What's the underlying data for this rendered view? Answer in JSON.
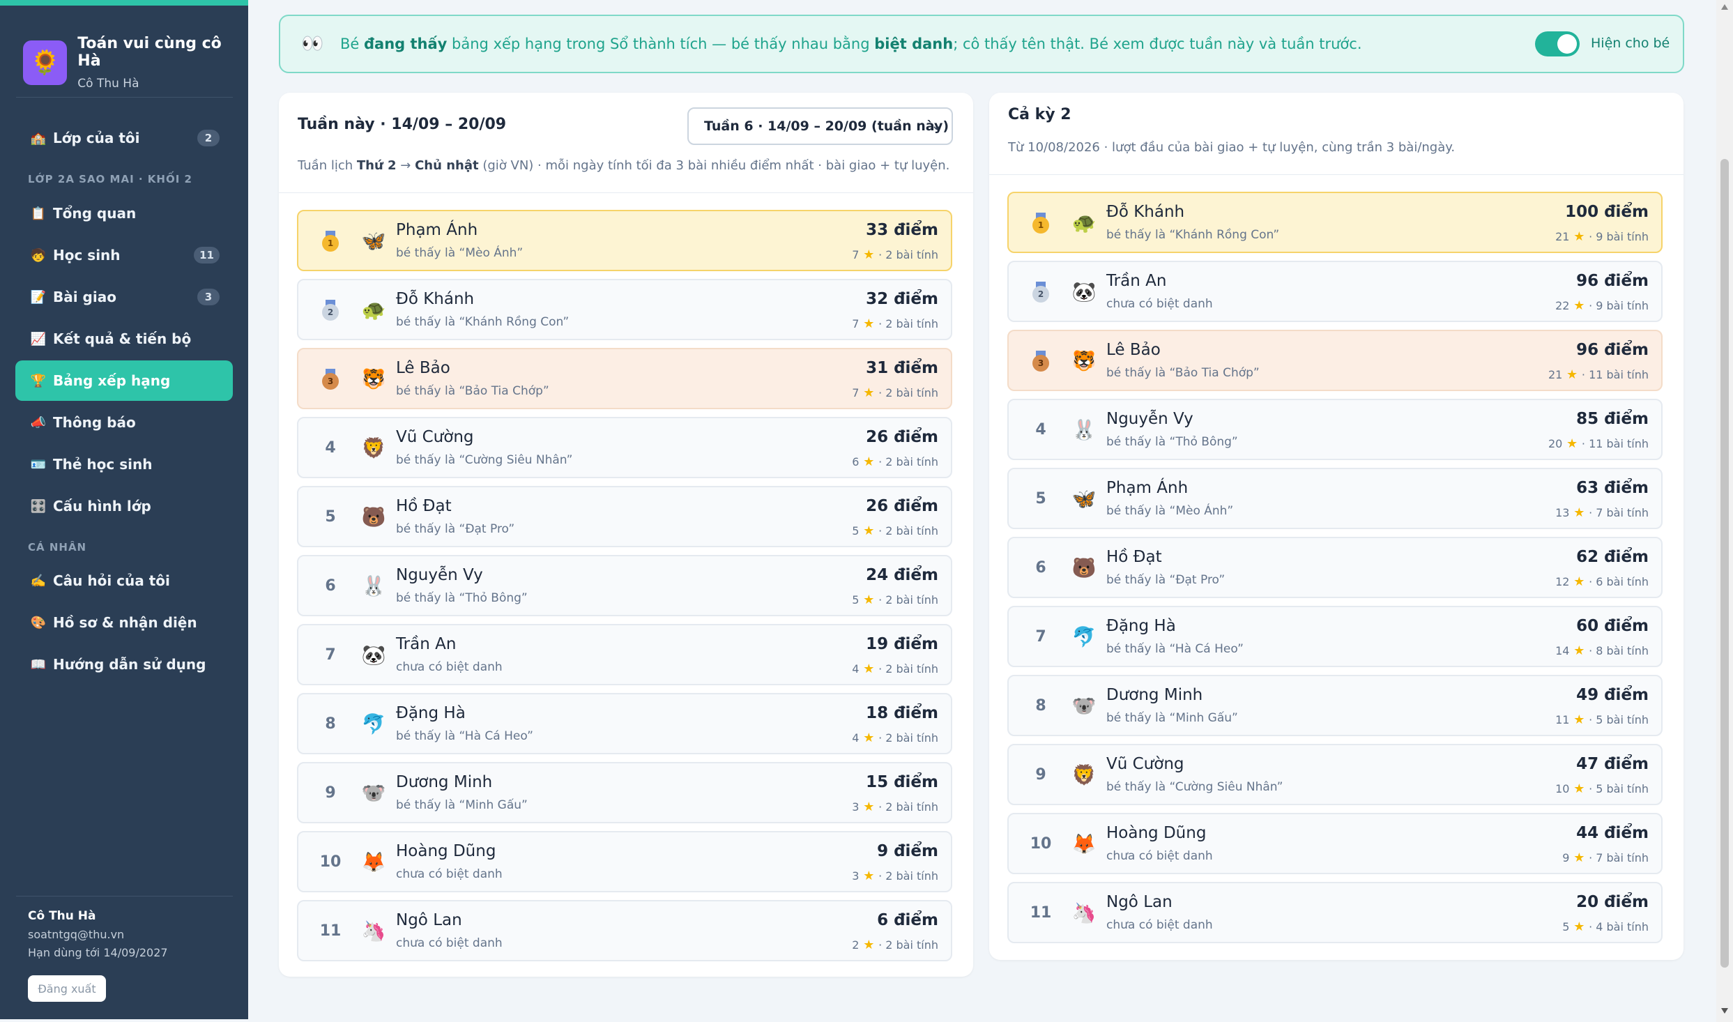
{
  "brand": {
    "logo": "🌻",
    "title": "Toán vui cùng cô Hà",
    "subtitle": "Cô Thu Hà"
  },
  "sidebar": {
    "top_item": {
      "icon": "🏫",
      "label": "Lớp của tôi",
      "badge": "2"
    },
    "class_section": "LỚP 2A SAO MAI · KHỐI 2",
    "class_items": [
      {
        "icon": "📋",
        "label": "Tổng quan",
        "badge": ""
      },
      {
        "icon": "🧒",
        "label": "Học sinh",
        "badge": "11"
      },
      {
        "icon": "📝",
        "label": "Bài giao",
        "badge": "3"
      },
      {
        "icon": "📈",
        "label": "Kết quả & tiến bộ",
        "badge": ""
      },
      {
        "icon": "🏆",
        "label": "Bảng xếp hạng",
        "badge": ""
      },
      {
        "icon": "📣",
        "label": "Thông báo",
        "badge": ""
      },
      {
        "icon": "🪪",
        "label": "Thẻ học sinh",
        "badge": ""
      },
      {
        "icon": "🎛️",
        "label": "Cấu hình lớp",
        "badge": ""
      }
    ],
    "personal_section": "CÁ NHÂN",
    "personal_items": [
      {
        "icon": "✍️",
        "label": "Câu hỏi của tôi"
      },
      {
        "icon": "🎨",
        "label": "Hồ sơ & nhận diện"
      },
      {
        "icon": "📖",
        "label": "Hướng dẫn sử dụng"
      }
    ],
    "user": {
      "name": "Cô Thu Hà",
      "email": "soatntgq@thu.vn",
      "expiry": "Hạn dùng tới 14/09/2027",
      "logout": "Đăng xuất"
    }
  },
  "banner": {
    "icon": "👀",
    "t1": "Bé ",
    "b1": "đang thấy",
    "t2": " bảng xếp hạng trong Sổ thành tích — bé thấy nhau bằng ",
    "b2": "biệt danh",
    "t3": "; cô thấy tên thật. Bé xem được tuần này và tuần trước.",
    "toggle_label": "Hiện cho bé",
    "toggle_on": true
  },
  "week": {
    "title": "Tuần này · 14/09 – 20/09",
    "select_value": "Tuần 6 · 14/09 – 20/09 (tuần này)",
    "desc_1": "Tuần lịch ",
    "desc_b1": "Thứ 2",
    "desc_2": " → ",
    "desc_b2": "Chủ nhật",
    "desc_3": " (giờ VN) · mỗi ngày tính tối đa 3 bài nhiều điểm nhất · bài giao + tự luyện.",
    "rows": [
      {
        "rank": "1",
        "avatar": "🦋",
        "name": "Phạm Ánh",
        "nick": "bé thấy là “Mèo Ánh”",
        "score": "33 điểm",
        "stars": "7",
        "count": "· 2 bài tính"
      },
      {
        "rank": "2",
        "avatar": "🐢",
        "name": "Đỗ Khánh",
        "nick": "bé thấy là “Khánh Rồng Con”",
        "score": "32 điểm",
        "stars": "7",
        "count": "· 2 bài tính"
      },
      {
        "rank": "3",
        "avatar": "🐯",
        "name": "Lê Bảo",
        "nick": "bé thấy là “Bảo Tia Chớp”",
        "score": "31 điểm",
        "stars": "7",
        "count": "· 2 bài tính"
      },
      {
        "rank": "4",
        "avatar": "🦁",
        "name": "Vũ Cường",
        "nick": "bé thấy là “Cường Siêu Nhân”",
        "score": "26 điểm",
        "stars": "6",
        "count": "· 2 bài tính"
      },
      {
        "rank": "5",
        "avatar": "🐻",
        "name": "Hồ Đạt",
        "nick": "bé thấy là “Đạt Pro”",
        "score": "26 điểm",
        "stars": "5",
        "count": "· 2 bài tính"
      },
      {
        "rank": "6",
        "avatar": "🐰",
        "name": "Nguyễn Vy",
        "nick": "bé thấy là “Thỏ Bông”",
        "score": "24 điểm",
        "stars": "5",
        "count": "· 2 bài tính"
      },
      {
        "rank": "7",
        "avatar": "🐼",
        "name": "Trần An",
        "nick": "chưa có biệt danh",
        "score": "19 điểm",
        "stars": "4",
        "count": "· 2 bài tính"
      },
      {
        "rank": "8",
        "avatar": "🐬",
        "name": "Đặng Hà",
        "nick": "bé thấy là “Hà Cá Heo”",
        "score": "18 điểm",
        "stars": "4",
        "count": "· 2 bài tính"
      },
      {
        "rank": "9",
        "avatar": "🐨",
        "name": "Dương Minh",
        "nick": "bé thấy là “Minh Gấu”",
        "score": "15 điểm",
        "stars": "3",
        "count": "· 2 bài tính"
      },
      {
        "rank": "10",
        "avatar": "🦊",
        "name": "Hoàng Dũng",
        "nick": "chưa có biệt danh",
        "score": "9 điểm",
        "stars": "3",
        "count": "· 2 bài tính"
      },
      {
        "rank": "11",
        "avatar": "🦄",
        "name": "Ngô Lan",
        "nick": "chưa có biệt danh",
        "score": "6 điểm",
        "stars": "2",
        "count": "· 2 bài tính"
      }
    ]
  },
  "term": {
    "title": "Cả kỳ 2",
    "desc": "Từ 10/08/2026 · lượt đầu của bài giao + tự luyện, cùng trần 3 bài/ngày.",
    "rows": [
      {
        "rank": "1",
        "avatar": "🐢",
        "name": "Đỗ Khánh",
        "nick": "bé thấy là “Khánh Rồng Con”",
        "score": "100 điểm",
        "stars": "21",
        "count": "· 9 bài tính"
      },
      {
        "rank": "2",
        "avatar": "🐼",
        "name": "Trần An",
        "nick": "chưa có biệt danh",
        "score": "96 điểm",
        "stars": "22",
        "count": "· 9 bài tính"
      },
      {
        "rank": "3",
        "avatar": "🐯",
        "name": "Lê Bảo",
        "nick": "bé thấy là “Bảo Tia Chớp”",
        "score": "96 điểm",
        "stars": "21",
        "count": "· 11 bài tính"
      },
      {
        "rank": "4",
        "avatar": "🐰",
        "name": "Nguyễn Vy",
        "nick": "bé thấy là “Thỏ Bông”",
        "score": "85 điểm",
        "stars": "20",
        "count": "· 11 bài tính"
      },
      {
        "rank": "5",
        "avatar": "🦋",
        "name": "Phạm Ánh",
        "nick": "bé thấy là “Mèo Ánh”",
        "score": "63 điểm",
        "stars": "13",
        "count": "· 7 bài tính"
      },
      {
        "rank": "6",
        "avatar": "🐻",
        "name": "Hồ Đạt",
        "nick": "bé thấy là “Đạt Pro”",
        "score": "62 điểm",
        "stars": "12",
        "count": "· 6 bài tính"
      },
      {
        "rank": "7",
        "avatar": "🐬",
        "name": "Đặng Hà",
        "nick": "bé thấy là “Hà Cá Heo”",
        "score": "60 điểm",
        "stars": "14",
        "count": "· 8 bài tính"
      },
      {
        "rank": "8",
        "avatar": "🐨",
        "name": "Dương Minh",
        "nick": "bé thấy là “Minh Gấu”",
        "score": "49 điểm",
        "stars": "11",
        "count": "· 5 bài tính"
      },
      {
        "rank": "9",
        "avatar": "🦁",
        "name": "Vũ Cường",
        "nick": "bé thấy là “Cường Siêu Nhân”",
        "score": "47 điểm",
        "stars": "10",
        "count": "· 5 bài tính"
      },
      {
        "rank": "10",
        "avatar": "🦊",
        "name": "Hoàng Dũng",
        "nick": "chưa có biệt danh",
        "score": "44 điểm",
        "stars": "9",
        "count": "· 7 bài tính"
      },
      {
        "rank": "11",
        "avatar": "🦄",
        "name": "Ngô Lan",
        "nick": "chưa có biệt danh",
        "score": "20 điểm",
        "stars": "5",
        "count": "· 4 bài tính"
      }
    ]
  },
  "colors": {
    "accent": "#2ec4a9",
    "sidebar": "#2b3e55",
    "gold_row": "#fdf4d3",
    "bronze_row": "#fceee4"
  }
}
